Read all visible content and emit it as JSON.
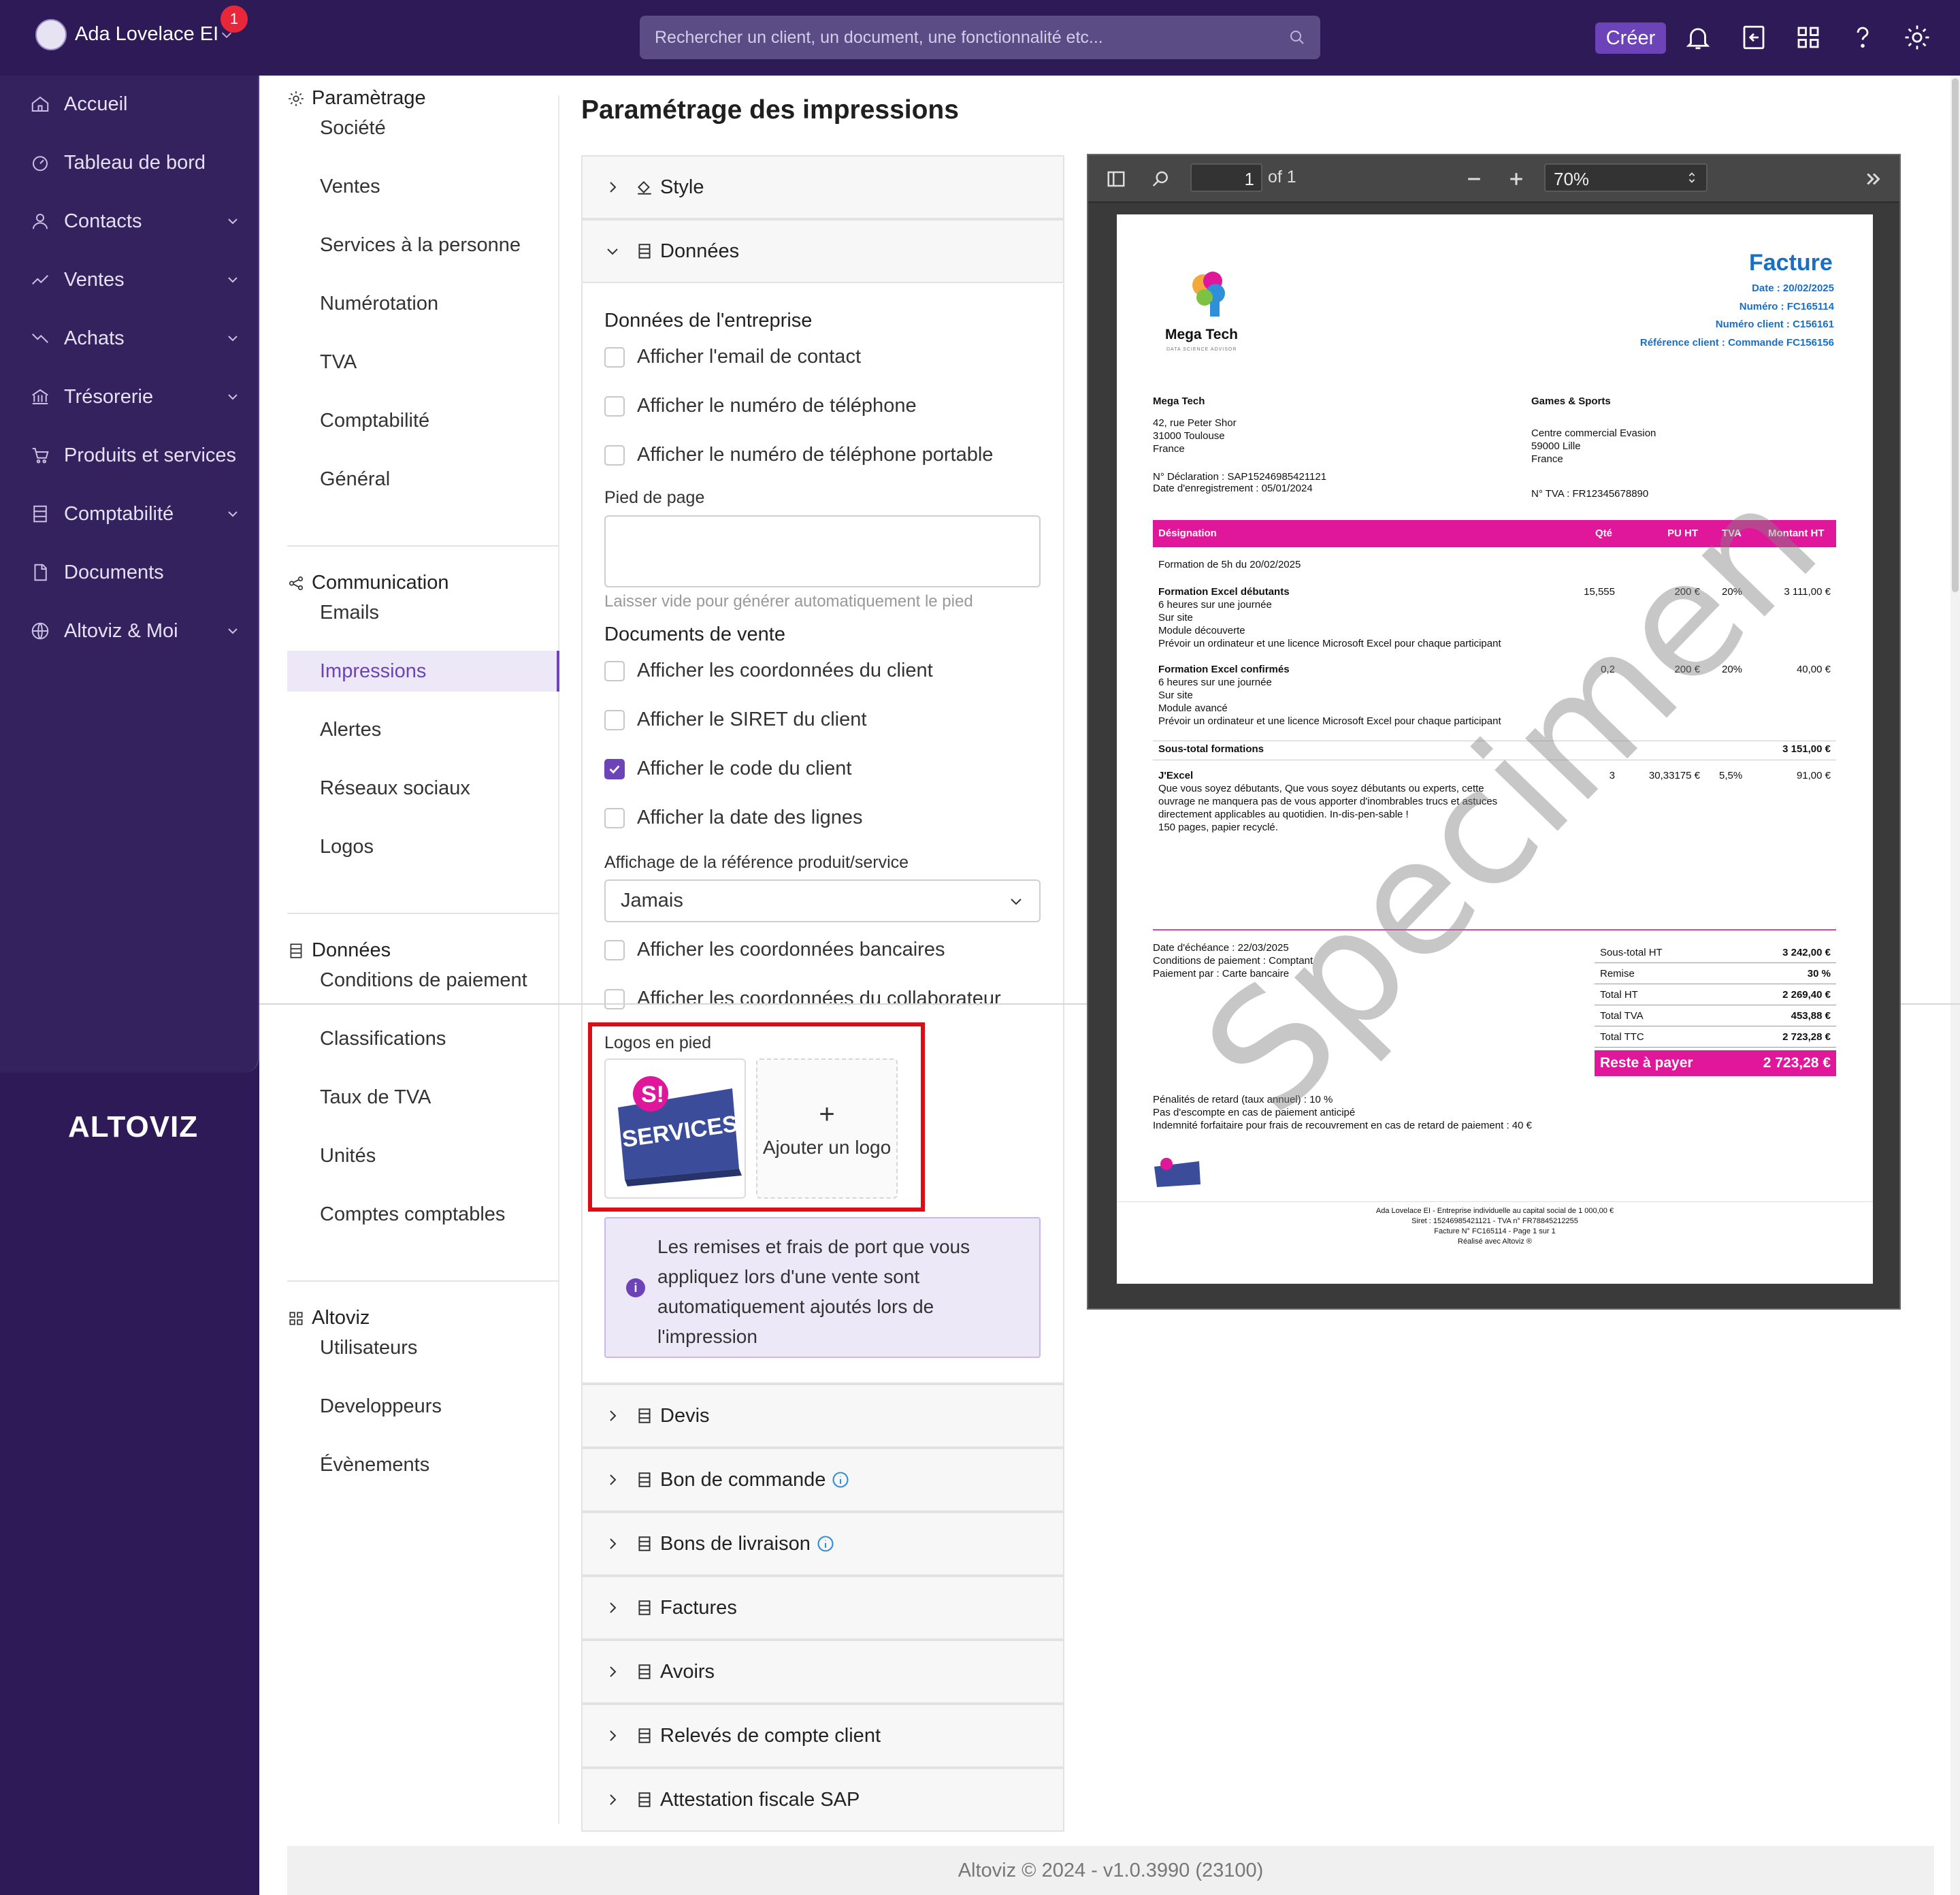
{
  "topbar": {
    "user_name": "Ada Lovelace EI",
    "notification_count": "1",
    "search_placeholder": "Rechercher un client, un document, une fonctionnalité etc...",
    "create_label": "Créer"
  },
  "sidebar": {
    "items": [
      {
        "label": "Accueil",
        "icon": "home-icon"
      },
      {
        "label": "Tableau de bord",
        "icon": "dashboard-icon"
      },
      {
        "label": "Contacts",
        "icon": "user-icon"
      },
      {
        "label": "Ventes",
        "icon": "trend-up-icon"
      },
      {
        "label": "Achats",
        "icon": "trend-down-icon"
      },
      {
        "label": "Trésorerie",
        "icon": "bank-icon"
      },
      {
        "label": "Produits et services",
        "icon": "cart-icon"
      },
      {
        "label": "Comptabilité",
        "icon": "ledger-icon"
      },
      {
        "label": "Documents",
        "icon": "document-icon"
      },
      {
        "label": "Altoviz & Moi",
        "icon": "globe-icon"
      }
    ],
    "logo": "ALTOVIZ"
  },
  "settings_nav": {
    "groups": [
      {
        "title": "Paramètrage",
        "items": [
          "Société",
          "Ventes",
          "Services à la personne",
          "Numérotation",
          "TVA",
          "Comptabilité",
          "Général"
        ]
      },
      {
        "title": "Communication",
        "items": [
          "Emails",
          "Impressions",
          "Alertes",
          "Réseaux sociaux",
          "Logos"
        ]
      },
      {
        "title": "Données",
        "items": [
          "Conditions de paiement",
          "Classifications",
          "Taux de TVA",
          "Unités",
          "Comptes comptables"
        ]
      },
      {
        "title": "Altoviz",
        "items": [
          "Utilisateurs",
          "Developpeurs",
          "Évènements"
        ]
      }
    ],
    "active": "Impressions"
  },
  "main": {
    "title": "Paramétrage des impressions",
    "accordions_top": [
      "Style",
      "Données"
    ],
    "accordions_bottom": [
      "Devis",
      "Bon de commande",
      "Bons de livraison",
      "Factures",
      "Avoirs",
      "Relevés de compte client",
      "Attestation fiscale SAP"
    ],
    "entreprise_title": "Données de l'entreprise",
    "entreprise_options": [
      {
        "label": "Afficher l'email de contact",
        "checked": false
      },
      {
        "label": "Afficher le numéro de téléphone",
        "checked": false
      },
      {
        "label": "Afficher le numéro de téléphone portable",
        "checked": false
      }
    ],
    "footer_label": "Pied de page",
    "footer_hint": "Laisser vide pour générer automatiquement le pied",
    "vente_title": "Documents de vente",
    "vente_options": [
      {
        "label": "Afficher les coordonnées du client",
        "checked": false
      },
      {
        "label": "Afficher le SIRET du client",
        "checked": false
      },
      {
        "label": "Afficher le code du client",
        "checked": true
      },
      {
        "label": "Afficher la date des lignes",
        "checked": false
      }
    ],
    "ref_label": "Affichage de la référence produit/service",
    "ref_value": "Jamais",
    "more_options": [
      {
        "label": "Afficher les coordonnées bancaires",
        "checked": false
      },
      {
        "label": "Afficher les coordonnées du collaborateur",
        "checked": false
      }
    ],
    "logos_label": "Logos en pied",
    "logo_tile_text": "SERVICES À LA PERSONNE",
    "add_logo": "Ajouter un logo",
    "info_text": "Les remises et frais de port que vous appliquez lors d'une vente sont automatiquement ajoutés lors de l'impression"
  },
  "viewer": {
    "page_input": "1",
    "page_of": "of 1",
    "zoom": "70%"
  },
  "invoice": {
    "title": "Facture",
    "date": "Date : 20/02/2025",
    "numero": "Numéro : FC165114",
    "numero_client": "Numéro client : C156161",
    "reference": "Référence client : Commande FC156156",
    "company_logo_name": "Mega Tech",
    "company_logo_tagline": "DATA SCIENCE ADVISOR",
    "seller": [
      "Mega Tech",
      "42, rue Peter Shor",
      "31000 Toulouse",
      "France",
      "N° Déclaration : SAP15246985421121",
      "Date d'enregistrement : 05/01/2024"
    ],
    "buyer": [
      "Games & Sports",
      "Centre commercial Evasion",
      "59000 Lille",
      "France",
      "N° TVA : FR12345678890"
    ],
    "headers": [
      "Désignation",
      "Qté",
      "PU HT",
      "TVA",
      "Montant HT"
    ],
    "section": "Formation de 5h du 20/02/2025",
    "lines": [
      {
        "title": "Formation Excel débutants",
        "desc": [
          "6 heures sur une journée",
          "Sur site",
          "Module découverte",
          "Prévoir un ordinateur et une licence Microsoft Excel pour chaque participant"
        ],
        "qty": "15,555",
        "pu": "200 €",
        "tva": "20%",
        "montant": "3 111,00 €"
      },
      {
        "title": "Formation Excel confirmés",
        "desc": [
          "6 heures sur une journée",
          "Sur site",
          "Module avancé",
          "Prévoir un ordinateur et une licence Microsoft Excel pour chaque participant"
        ],
        "qty": "0,2",
        "pu": "200 €",
        "tva": "20%",
        "montant": "40,00 €"
      }
    ],
    "subtotal_label": "Sous-total formations",
    "subtotal_value": "3 151,00 €",
    "book": {
      "title": "J'Excel",
      "desc": [
        "Que vous soyez débutants, Que vous soyez débutants ou experts, cette",
        "ouvrage ne manquera pas de vous apporter d'inombrables trucs et astuces",
        "directement applicables au quotidien. In-dis-pen-sable !",
        "150 pages, papier recyclé."
      ],
      "qty": "3",
      "pu": "30,33175 €",
      "tva": "5,5%",
      "montant": "91,00 €"
    },
    "terms": [
      "Date d'échéance : 22/03/2025",
      "Conditions de paiement : Comptant",
      "Paiement par : Carte bancaire"
    ],
    "totals": [
      {
        "label": "Sous-total HT",
        "value": "3 242,00 €"
      },
      {
        "label": "Remise",
        "value": "30 %"
      },
      {
        "label": "Total HT",
        "value": "2 269,40 €"
      },
      {
        "label": "Total TVA",
        "value": "453,88 €"
      },
      {
        "label": "Total TTC",
        "value": "2 723,28 €"
      }
    ],
    "reste_label": "Reste à payer",
    "reste_value": "2 723,28 €",
    "penalties": [
      "Pénalités de retard (taux annuel) : 10 %",
      "Pas d'escompte en cas de paiement anticipé",
      "Indemnité forfaitaire pour frais de recouvrement en cas de retard de paiement : 40 €"
    ],
    "legal": [
      "Ada Lovelace EI - Entreprise individuelle au capital social de 1 000,00 €",
      "Siret : 15246985421121 - TVA n° FR78845212255",
      "Facture N° FC165114 - Page 1 sur 1",
      "Réalisé avec Altoviz ®"
    ],
    "watermark": "Specimen"
  },
  "footer": "Altoviz © 2024 - v1.0.3990 (23100)",
  "colors": {
    "brand": "#2d1a57",
    "accent": "#6c43b8",
    "invoice_pink": "#e0179a",
    "highlight_red": "#d80f16"
  }
}
